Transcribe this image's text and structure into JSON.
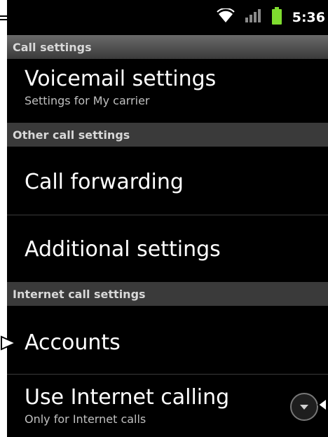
{
  "status_bar": {
    "time": "5:36",
    "icons": [
      "wifi-icon",
      "signal-icon",
      "battery-icon"
    ]
  },
  "colors": {
    "background": "#000000",
    "header_bg": "#3a3a3a",
    "battery": "#7fdc2f",
    "wifi": "#ffffff"
  },
  "sections": {
    "call_settings": "Call settings",
    "other_call_settings": "Other call settings",
    "internet_call_settings": "Internet call settings"
  },
  "items": {
    "voicemail": {
      "title": "Voicemail settings",
      "subtitle": "Settings for My carrier"
    },
    "call_forwarding": {
      "title": "Call forwarding"
    },
    "additional": {
      "title": "Additional settings"
    },
    "accounts": {
      "title": "Accounts"
    },
    "use_internet_calling": {
      "title": "Use Internet calling",
      "subtitle": "Only for Internet calls"
    }
  }
}
